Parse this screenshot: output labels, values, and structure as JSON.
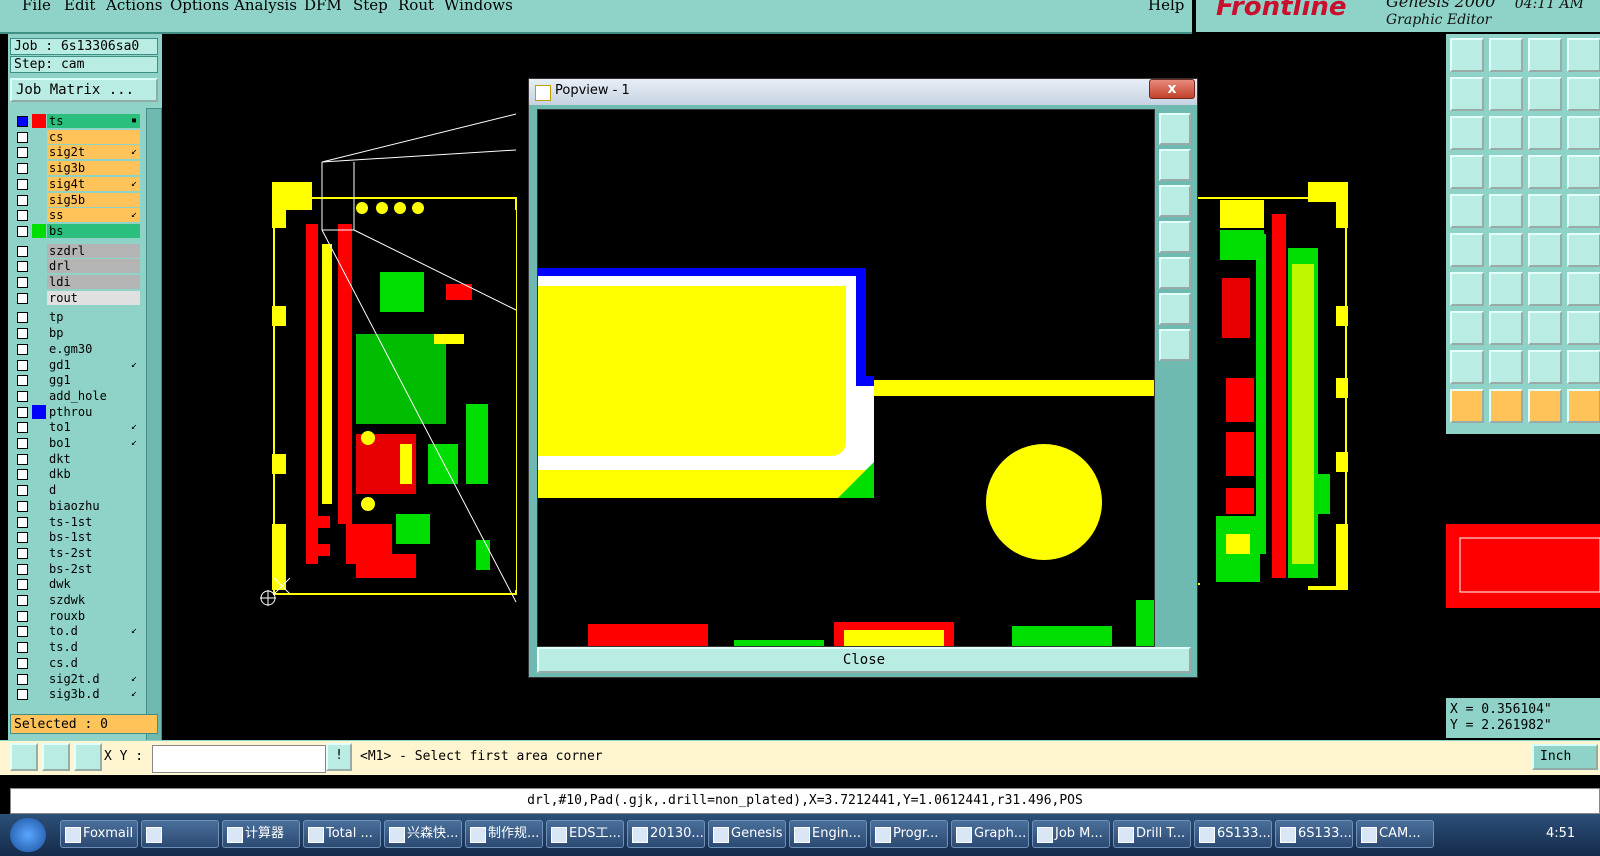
{
  "menubar": {
    "items": [
      "File",
      "Edit",
      "Actions",
      "Options",
      "Analysis",
      "DFM",
      "Step",
      "Rout",
      "Windows"
    ],
    "help": "Help"
  },
  "brand": {
    "logo": "Frontline",
    "product": "Genesis 2000",
    "subtitle": "Graphic Editor",
    "time": "04:11 AM"
  },
  "left_panel": {
    "job": "Job : 6s13306sa0",
    "step": "Step: cam",
    "job_matrix_button": "Job Matrix ...",
    "selected": "Selected : 0",
    "layers": [
      {
        "name": "ts",
        "bg": "#2bbf7e",
        "swatch": "#ff0000",
        "checked": true,
        "mark": "▪"
      },
      {
        "name": "cs",
        "bg": "#ffc35a",
        "swatch": "",
        "checked": false,
        "mark": ""
      },
      {
        "name": "sig2t",
        "bg": "#ffc35a",
        "swatch": "",
        "checked": false,
        "mark": "↙"
      },
      {
        "name": "sig3b",
        "bg": "#ffc35a",
        "swatch": "",
        "checked": false,
        "mark": ""
      },
      {
        "name": "sig4t",
        "bg": "#ffc35a",
        "swatch": "",
        "checked": false,
        "mark": "↙"
      },
      {
        "name": "sig5b",
        "bg": "#ffc35a",
        "swatch": "",
        "checked": false,
        "mark": ""
      },
      {
        "name": "ss",
        "bg": "#ffc35a",
        "swatch": "",
        "checked": false,
        "mark": "↙"
      },
      {
        "name": "bs",
        "bg": "#2bbf7e",
        "swatch": "#00dd00",
        "checked": false,
        "mark": ""
      },
      {
        "name": "szdrl",
        "bg": "#b4b4b4",
        "swatch": "",
        "checked": false,
        "mark": ""
      },
      {
        "name": "drl",
        "bg": "#b4b4b4",
        "swatch": "",
        "checked": false,
        "mark": ""
      },
      {
        "name": "ldi",
        "bg": "#b4b4b4",
        "swatch": "",
        "checked": false,
        "mark": ""
      },
      {
        "name": "rout",
        "bg": "#e0e0e0",
        "swatch": "",
        "checked": false,
        "mark": ""
      },
      {
        "name": "tp",
        "bg": "#8fd3c8",
        "swatch": "",
        "checked": false,
        "mark": ""
      },
      {
        "name": "bp",
        "bg": "#8fd3c8",
        "swatch": "",
        "checked": false,
        "mark": ""
      },
      {
        "name": "e.gm30",
        "bg": "#8fd3c8",
        "swatch": "",
        "checked": false,
        "mark": ""
      },
      {
        "name": "gd1",
        "bg": "#8fd3c8",
        "swatch": "",
        "checked": false,
        "mark": "↙"
      },
      {
        "name": "gg1",
        "bg": "#8fd3c8",
        "swatch": "",
        "checked": false,
        "mark": ""
      },
      {
        "name": "add_hole",
        "bg": "#8fd3c8",
        "swatch": "",
        "checked": false,
        "mark": ""
      },
      {
        "name": "pthrou",
        "bg": "#8fd3c8",
        "swatch": "#0000ff",
        "checked": false,
        "mark": ""
      },
      {
        "name": "to1",
        "bg": "#8fd3c8",
        "swatch": "",
        "checked": false,
        "mark": "↙"
      },
      {
        "name": "bo1",
        "bg": "#8fd3c8",
        "swatch": "",
        "checked": false,
        "mark": "↙"
      },
      {
        "name": "dkt",
        "bg": "#8fd3c8",
        "swatch": "",
        "checked": false,
        "mark": ""
      },
      {
        "name": "dkb",
        "bg": "#8fd3c8",
        "swatch": "",
        "checked": false,
        "mark": ""
      },
      {
        "name": "d",
        "bg": "#8fd3c8",
        "swatch": "",
        "checked": false,
        "mark": ""
      },
      {
        "name": "biaozhu",
        "bg": "#8fd3c8",
        "swatch": "",
        "checked": false,
        "mark": ""
      },
      {
        "name": "ts-1st",
        "bg": "#8fd3c8",
        "swatch": "",
        "checked": false,
        "mark": ""
      },
      {
        "name": "bs-1st",
        "bg": "#8fd3c8",
        "swatch": "",
        "checked": false,
        "mark": ""
      },
      {
        "name": "ts-2st",
        "bg": "#8fd3c8",
        "swatch": "",
        "checked": false,
        "mark": ""
      },
      {
        "name": "bs-2st",
        "bg": "#8fd3c8",
        "swatch": "",
        "checked": false,
        "mark": ""
      },
      {
        "name": "dwk",
        "bg": "#8fd3c8",
        "swatch": "",
        "checked": false,
        "mark": ""
      },
      {
        "name": "szdwk",
        "bg": "#8fd3c8",
        "swatch": "",
        "checked": false,
        "mark": ""
      },
      {
        "name": "rouxb",
        "bg": "#8fd3c8",
        "swatch": "",
        "checked": false,
        "mark": ""
      },
      {
        "name": "to.d",
        "bg": "#8fd3c8",
        "swatch": "",
        "checked": false,
        "mark": "↙"
      },
      {
        "name": "ts.d",
        "bg": "#8fd3c8",
        "swatch": "",
        "checked": false,
        "mark": ""
      },
      {
        "name": "cs.d",
        "bg": "#8fd3c8",
        "swatch": "",
        "checked": false,
        "mark": ""
      },
      {
        "name": "sig2t.d",
        "bg": "#8fd3c8",
        "swatch": "",
        "checked": false,
        "mark": "↙"
      },
      {
        "name": "sig3b.d",
        "bg": "#8fd3c8",
        "swatch": "",
        "checked": false,
        "mark": "↙"
      }
    ]
  },
  "popview": {
    "title": "Popview - 1",
    "close_x": "x",
    "close_button": "Close"
  },
  "coords": {
    "x": "X = 0.356104\"",
    "y": "Y = 2.261982\""
  },
  "command": {
    "xy_label": "X Y :",
    "xy_value": "",
    "prompt": "<M1> - Select first area corner",
    "units": "Inch"
  },
  "status": "drl,#10,Pad(.gjk,.drill=non_plated),X=3.7212441,Y=1.0612441,r31.496,POS",
  "taskbar": {
    "tasks": [
      "Foxmail",
      "",
      "计算器",
      "Total ...",
      "兴森快...",
      "制作规...",
      "EDS工...",
      "20130...",
      "Genesis",
      "Engin...",
      "Progr...",
      "Graph...",
      "Job M...",
      "Drill T...",
      "6S133...",
      "6S133...",
      "CAM..."
    ],
    "clock": "4:51"
  },
  "colors": {
    "ui_bg": "#8fd3c8",
    "layer_orange": "#ffc35a",
    "layer_green": "#2bbf7e",
    "pad_yellow": "#ffff00",
    "pad_red": "#ff0000",
    "pad_green": "#00dd00"
  }
}
